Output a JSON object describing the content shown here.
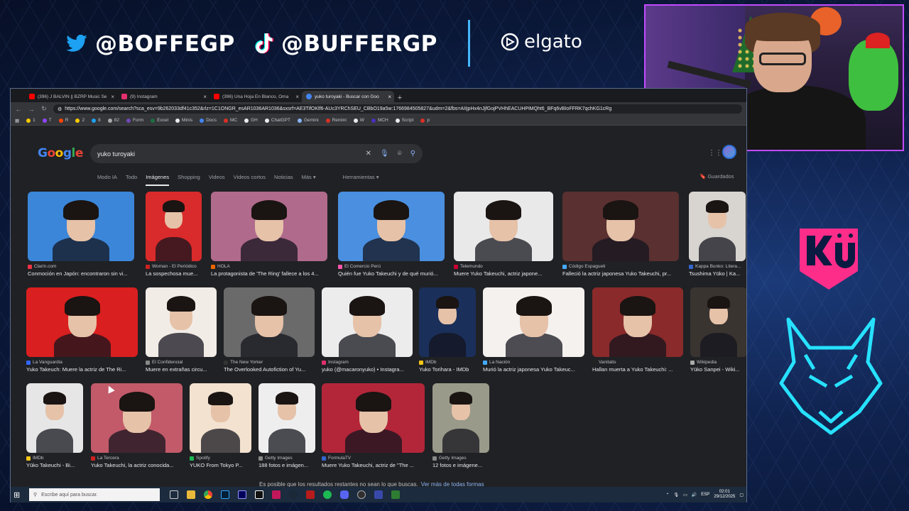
{
  "overlay": {
    "twitter_handle": "@BOFFEGP",
    "tiktok_handle": "@BUFFERGP",
    "sponsor": "elgato"
  },
  "browser": {
    "tabs": [
      {
        "title": "(396) J BALVIN || BZRP Music Se",
        "color": "#ff0000"
      },
      {
        "title": "(9) Instagram",
        "color": "#e1306c"
      },
      {
        "title": "(396) Una Hoja En Blanco, Oma",
        "color": "#ff0000"
      },
      {
        "title": "yuko turoyaki - Buscar con Goo",
        "color": "#4285f4",
        "active": true
      }
    ],
    "url": "https://www.google.com/search?sca_esv=9b262033df41c352&rlz=1C1ONGR_esAR1036AR1036&sxsrf=AE3TifOKlf6-AUc3YRChSEU_CBbO19a5w:1766984505827&udm=2&fbs=AIIjpHx4nJjfGojPVHhEACUHPiMQht6_BFq6vBIoFFRK7qchKG1cRg",
    "bookmarks": [
      {
        "label": "1",
        "color": "#ffcc00"
      },
      {
        "label": "T",
        "color": "#9146ff"
      },
      {
        "label": "R",
        "color": "#ff4500"
      },
      {
        "label": "2",
        "color": "#ffcc00"
      },
      {
        "label": "8",
        "color": "#1da1f2"
      },
      {
        "label": "82",
        "color": "#aaaaaa"
      },
      {
        "label": "Form",
        "color": "#7248b9"
      },
      {
        "label": "Excel",
        "color": "#1d6f42"
      },
      {
        "label": "Minis",
        "color": "#e8eaed"
      },
      {
        "label": "Docs",
        "color": "#4285f4"
      },
      {
        "label": "MC",
        "color": "#d93025"
      },
      {
        "label": "GH",
        "color": "#e8eaed"
      },
      {
        "label": "ChatGPT",
        "color": "#e8eaed"
      },
      {
        "label": "Gemini",
        "color": "#8ab4f8"
      },
      {
        "label": "Remini",
        "color": "#d93025"
      },
      {
        "label": "W",
        "color": "#e8eaed"
      },
      {
        "label": "MCH",
        "color": "#4a2fbd"
      },
      {
        "label": "Script",
        "color": "#e8eaed"
      },
      {
        "label": "p",
        "color": "#d93025"
      }
    ]
  },
  "google": {
    "logo": "Google",
    "query": "yuko turoyaki",
    "tabs": [
      "Modo IA",
      "Todo",
      "Imágenes",
      "Shopping",
      "Videos",
      "Videos cortos",
      "Noticias",
      "Más ▾"
    ],
    "active_tab": "Imágenes",
    "tools": "Herramientas ▾",
    "saved": "Guardados",
    "results": [
      {
        "source": "Clarín.com",
        "caption": "Conmoción en Japón: encontraron sin vi...",
        "bg": "#3b86d9"
      },
      {
        "source": "Woman - El Periódico",
        "caption": "La sospechosa mue...",
        "bg": "#d92b2b"
      },
      {
        "source": "HOLA",
        "caption": "La protagonista de 'The Ring' fallece a los 4...",
        "bg": "#b06a8c"
      },
      {
        "source": "El Comercio Perú",
        "caption": "Quién fue Yuko Takeuchi y de qué murió...",
        "bg": "#4a8fe0"
      },
      {
        "source": "Telemundo",
        "caption": "Muere Yuko Takeuchi, actriz japone...",
        "bg": "#e9e9e9"
      },
      {
        "source": "Código Espagueti",
        "caption": "Falleció la actriz japonesa Yuko Takeuchi, pr...",
        "bg": "#5a3030"
      },
      {
        "source": "Kappa Bunko: Litera...",
        "caption": "Tsushima Yūko | Ka...",
        "bg": "#d8d4d0"
      },
      {
        "source": "La Vanguardia",
        "caption": "Yuko Takeuch: Muere la actriz de The Ri...",
        "bg": "#d91f1f"
      },
      {
        "source": "El Confidencial",
        "caption": "Muere en extrañas circu...",
        "bg": "#f2ece6"
      },
      {
        "source": "The New Yorker",
        "caption": "The Overlooked Autofiction of Yu...",
        "bg": "#6a6a6a"
      },
      {
        "source": "Instagram",
        "caption": "yuko (@macaronyuko) • Instagra...",
        "bg": "#ececec"
      },
      {
        "source": "IMDb",
        "caption": "Yuko Torihara - IMDb",
        "bg": "#1a2f5a"
      },
      {
        "source": "La Nación",
        "caption": "Murió la actriz japonesa Yuko Takeuc...",
        "bg": "#f4f1ee"
      },
      {
        "source": "Vanitatis",
        "caption": "Hallan muerta a Yuko Takeuchi: ...",
        "bg": "#8a2a2a"
      },
      {
        "source": "Wikipedia",
        "caption": "Yūko Sanpei - Wiki...",
        "bg": "#3a3430"
      },
      {
        "source": "IMDb",
        "caption": "Yūko Takeuchi - Bi...",
        "bg": "#e6e6e6"
      },
      {
        "source": "La Tercera",
        "caption": "Yuko Takeuchi, la actriz conocida...",
        "bg": "#c25a6a"
      },
      {
        "source": "Spotify",
        "caption": "YUKO From Tokyo P...",
        "bg": "#f2e2cf"
      },
      {
        "source": "Getty Images",
        "caption": "188 fotos e imágen...",
        "bg": "#eeeeee"
      },
      {
        "source": "FormulaTV",
        "caption": "Muere Yuko Takeuchi, actriz de \"The ...",
        "bg": "#b3263a"
      },
      {
        "source": "Getty Images",
        "caption": "12 fotos e imágene...",
        "bg": "#9a9a8a"
      }
    ],
    "more_text": "Es posible que los resultados restantes no sean lo que buscas.",
    "more_link": "Ver más de todas formas"
  },
  "taskbar": {
    "search_placeholder": "Escribe aquí para buscar.",
    "lang": "ESP",
    "time": "02:01",
    "date": "29/12/2025"
  }
}
